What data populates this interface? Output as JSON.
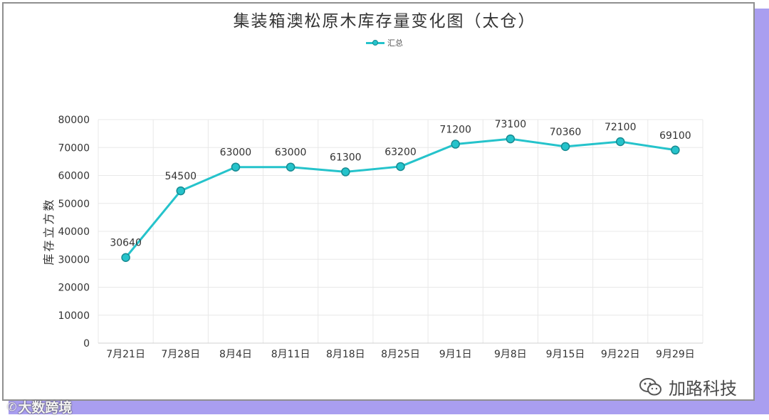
{
  "title": "集装箱澳松原木库存量变化图（太仓）",
  "legend": {
    "series_label": "汇总"
  },
  "ylabel": "库存立方数",
  "watermarks": {
    "left_text": "大数跨境",
    "right_text": "加路科技",
    "left_icon": "sogou-icon",
    "right_icon": "wechat-icon"
  },
  "colors": {
    "line": "#25c3cb",
    "marker_stroke": "#178a91",
    "grid": "#e8e8e8",
    "shadow": "#a99ef0"
  },
  "chart_data": {
    "type": "line",
    "title": "集装箱澳松原木库存量变化图（太仓）",
    "xlabel": "",
    "ylabel": "库存立方数",
    "categories": [
      "7月21日",
      "7月28日",
      "8月4日",
      "8月11日",
      "8月18日",
      "8月25日",
      "9月1日",
      "9月8日",
      "9月15日",
      "9月22日",
      "9月29日"
    ],
    "series": [
      {
        "name": "汇总",
        "values": [
          30640,
          54500,
          63000,
          63000,
          61300,
          63200,
          71200,
          73100,
          70360,
          72100,
          69100
        ]
      }
    ],
    "ylim": [
      0,
      80000
    ],
    "yticks": [
      0,
      10000,
      20000,
      30000,
      40000,
      50000,
      60000,
      70000,
      80000
    ],
    "data_labels": true,
    "grid": true,
    "legend_position": "top-center"
  }
}
